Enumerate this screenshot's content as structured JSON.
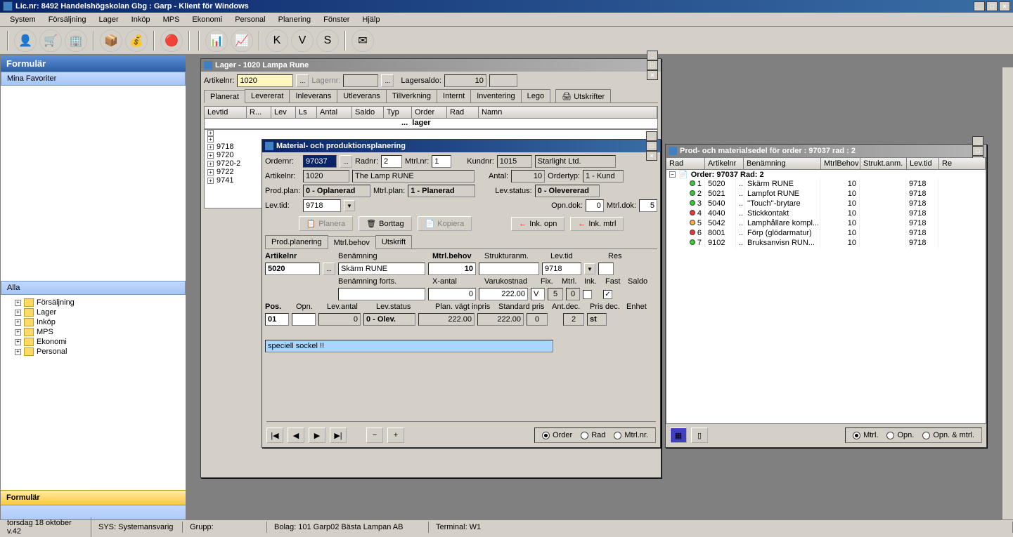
{
  "main_title": "Lic.nr: 8492 Handelshögskolan Gbg  :  Garp - Klient för Windows",
  "menu": [
    "System",
    "Försäljning",
    "Lager",
    "Inköp",
    "MPS",
    "Ekonomi",
    "Personal",
    "Planering",
    "Fönster",
    "Hjälp"
  ],
  "sidebar": {
    "header": "Formulär",
    "favorites": "Mina Favoriter",
    "all": "Alla",
    "items": [
      "Försäljning",
      "Lager",
      "Inköp",
      "MPS",
      "Ekonomi",
      "Personal"
    ],
    "footer": "Formulär"
  },
  "lager": {
    "title": "Lager  - 1020 Lampa Rune",
    "artikelnr_lbl": "Artikelnr:",
    "artikelnr": "1020",
    "lagernr_lbl": "Lagernr:",
    "lagersaldo_lbl": "Lagersaldo:",
    "lagersaldo": "10",
    "tabs": [
      "Planerat",
      "Levererat",
      "Inleverans",
      "Utleverans",
      "Tillverkning",
      "Internt",
      "Inventering",
      "Lego"
    ],
    "utskrifter": "Utskrifter",
    "headers": [
      "Levtid",
      "R...",
      "Lev",
      "Ls",
      "Antal",
      "Saldo",
      "Typ",
      "Order",
      "Rad",
      "Namn"
    ],
    "lager_row": "lager",
    "tree_items": [
      "",
      "",
      "9718",
      "9720",
      "9720-2",
      "9722",
      "9741"
    ]
  },
  "mpp": {
    "title": "Material- och produktionsplanering",
    "ordernr_lbl": "Ordernr:",
    "ordernr": "97037",
    "radnr_lbl": "Radnr:",
    "radnr": "2",
    "mtrlnr_lbl": "Mtrl.nr:",
    "mtrlnr": "1",
    "kundnr_lbl": "Kundnr:",
    "kundnr": "1015",
    "kundnamn": "Starlight Ltd.",
    "artikelnr_lbl": "Artikelnr:",
    "artikelnr": "1020",
    "artikelnamn": "The Lamp RUNE",
    "antal_lbl": "Antal:",
    "antal": "10",
    "ordertyp_lbl": "Ordertyp:",
    "ordertyp": "1 - Kund",
    "prodplan_lbl": "Prod.plan:",
    "prodplan": "0 - Oplanerad",
    "mtrlplan_lbl": "Mtrl.plan:",
    "mtrlplan": "1 - Planerad",
    "levstatus_lbl": "Lev.status:",
    "levstatus": "0 - Olevererad",
    "levtid_lbl": "Lev.tid:",
    "levtid": "9718",
    "opndok_lbl": "Opn.dok:",
    "opndok": "0",
    "mtrldok_lbl": "Mtrl.dok:",
    "mtrldok": "5",
    "planera_btn": "Planera",
    "borttag_btn": "Borttag",
    "kopiera_btn": "Kopiera",
    "inkopn_btn": "Ink. opn",
    "inkmtrl_btn": "Ink. mtrl",
    "tabs": [
      "Prod.planering",
      "Mtrl.behov",
      "Utskrift"
    ],
    "detail": {
      "artikelnr_lbl": "Artikelnr",
      "artikelnr": "5020",
      "benamning_lbl": "Benämning",
      "benamning": "Skärm RUNE",
      "mtrlbehov_lbl": "Mtrl.behov",
      "mtrlbehov": "10",
      "strukturanm_lbl": "Strukturanm.",
      "levtid_lbl": "Lev.tid",
      "levtid": "9718",
      "res_lbl": "Res",
      "benamning_forts_lbl": "Benämning forts.",
      "xantal_lbl": "X-antal",
      "xantal": "0",
      "varukostnad_lbl": "Varukostnad",
      "varukostnad": "222.00",
      "fix_lbl": "Fix.",
      "fix": "V",
      "mtrl_lbl": "Mtrl.",
      "mtrl": "5",
      "ink_lbl": "Ink.",
      "ink": "0",
      "fast_lbl": "Fast",
      "saldo_lbl": "Saldo",
      "pos_lbl": "Pos.",
      "pos": "01",
      "opn_lbl": "Opn.",
      "levantal_lbl": "Lev.antal",
      "levantal": "0",
      "levstatus_lbl": "Lev.status",
      "levstatus": "0 - Olev.",
      "plan_vagt_lbl": "Plan. vägt inpris",
      "plan_vagt": "222.00",
      "standard_pris_lbl": "Standard pris",
      "standard_pris": "222.00",
      "antdec_lbl": "Ant.dec.",
      "antdec": "0",
      "prisdec_lbl": "Pris dec.",
      "prisdec": "2",
      "enhet_lbl": "Enhet",
      "enhet": "st",
      "note": "speciell sockel !!"
    },
    "radios": [
      "Order",
      "Rad",
      "Mtrl.nr."
    ]
  },
  "pms": {
    "title": "Prod- och materialsedel för order : 97037  rad :  2",
    "headers": [
      "Rad",
      "Artikelnr",
      "Benämning",
      "MtrlBehov",
      "Strukt.anm.",
      "Lev.tid",
      "Re"
    ],
    "order_line": "Order: 97037  Rad: 2",
    "rows": [
      {
        "dot": "green",
        "rad": "1",
        "art": "5020",
        "ben": "Skärm RUNE",
        "mb": "10",
        "lt": "9718"
      },
      {
        "dot": "green",
        "rad": "2",
        "art": "5021",
        "ben": "Lampfot RUNE",
        "mb": "10",
        "lt": "9718"
      },
      {
        "dot": "green",
        "rad": "3",
        "art": "5040",
        "ben": "''Touch''-brytare",
        "mb": "10",
        "lt": "9718"
      },
      {
        "dot": "red",
        "rad": "4",
        "art": "4040",
        "ben": "Stickkontakt",
        "mb": "10",
        "lt": "9718"
      },
      {
        "dot": "orange",
        "rad": "5",
        "art": "5042",
        "ben": "Lamphållare kompl...",
        "mb": "10",
        "lt": "9718"
      },
      {
        "dot": "red",
        "rad": "6",
        "art": "8001",
        "ben": "Förp (glödarmatur)",
        "mb": "10",
        "lt": "9718"
      },
      {
        "dot": "green",
        "rad": "7",
        "art": "9102",
        "ben": "Bruksanvisn RUN...",
        "mb": "10",
        "lt": "9718"
      }
    ],
    "radios": [
      "Mtrl.",
      "Opn.",
      "Opn. & mtrl."
    ]
  },
  "status": {
    "date": "torsdag 18 oktober v.42",
    "sys": "SYS: Systemansvarig",
    "grupp": "Grupp:",
    "bolag": "Bolag: 101      Garp02 Bästa Lampan AB",
    "terminal": "Terminal: W1"
  }
}
